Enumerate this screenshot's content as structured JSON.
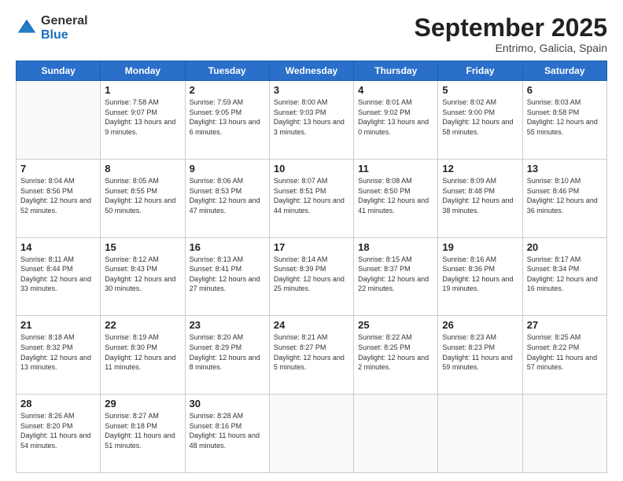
{
  "header": {
    "logo_general": "General",
    "logo_blue": "Blue",
    "month_title": "September 2025",
    "location": "Entrimo, Galicia, Spain"
  },
  "weekdays": [
    "Sunday",
    "Monday",
    "Tuesday",
    "Wednesday",
    "Thursday",
    "Friday",
    "Saturday"
  ],
  "weeks": [
    [
      {
        "day": null
      },
      {
        "day": 1,
        "sunrise": "7:58 AM",
        "sunset": "9:07 PM",
        "daylight": "13 hours and 9 minutes"
      },
      {
        "day": 2,
        "sunrise": "7:59 AM",
        "sunset": "9:05 PM",
        "daylight": "13 hours and 6 minutes"
      },
      {
        "day": 3,
        "sunrise": "8:00 AM",
        "sunset": "9:03 PM",
        "daylight": "13 hours and 3 minutes"
      },
      {
        "day": 4,
        "sunrise": "8:01 AM",
        "sunset": "9:02 PM",
        "daylight": "13 hours and 0 minutes"
      },
      {
        "day": 5,
        "sunrise": "8:02 AM",
        "sunset": "9:00 PM",
        "daylight": "12 hours and 58 minutes"
      },
      {
        "day": 6,
        "sunrise": "8:03 AM",
        "sunset": "8:58 PM",
        "daylight": "12 hours and 55 minutes"
      }
    ],
    [
      {
        "day": 7,
        "sunrise": "8:04 AM",
        "sunset": "8:56 PM",
        "daylight": "12 hours and 52 minutes"
      },
      {
        "day": 8,
        "sunrise": "8:05 AM",
        "sunset": "8:55 PM",
        "daylight": "12 hours and 50 minutes"
      },
      {
        "day": 9,
        "sunrise": "8:06 AM",
        "sunset": "8:53 PM",
        "daylight": "12 hours and 47 minutes"
      },
      {
        "day": 10,
        "sunrise": "8:07 AM",
        "sunset": "8:51 PM",
        "daylight": "12 hours and 44 minutes"
      },
      {
        "day": 11,
        "sunrise": "8:08 AM",
        "sunset": "8:50 PM",
        "daylight": "12 hours and 41 minutes"
      },
      {
        "day": 12,
        "sunrise": "8:09 AM",
        "sunset": "8:48 PM",
        "daylight": "12 hours and 38 minutes"
      },
      {
        "day": 13,
        "sunrise": "8:10 AM",
        "sunset": "8:46 PM",
        "daylight": "12 hours and 36 minutes"
      }
    ],
    [
      {
        "day": 14,
        "sunrise": "8:11 AM",
        "sunset": "8:44 PM",
        "daylight": "12 hours and 33 minutes"
      },
      {
        "day": 15,
        "sunrise": "8:12 AM",
        "sunset": "8:43 PM",
        "daylight": "12 hours and 30 minutes"
      },
      {
        "day": 16,
        "sunrise": "8:13 AM",
        "sunset": "8:41 PM",
        "daylight": "12 hours and 27 minutes"
      },
      {
        "day": 17,
        "sunrise": "8:14 AM",
        "sunset": "8:39 PM",
        "daylight": "12 hours and 25 minutes"
      },
      {
        "day": 18,
        "sunrise": "8:15 AM",
        "sunset": "8:37 PM",
        "daylight": "12 hours and 22 minutes"
      },
      {
        "day": 19,
        "sunrise": "8:16 AM",
        "sunset": "8:36 PM",
        "daylight": "12 hours and 19 minutes"
      },
      {
        "day": 20,
        "sunrise": "8:17 AM",
        "sunset": "8:34 PM",
        "daylight": "12 hours and 16 minutes"
      }
    ],
    [
      {
        "day": 21,
        "sunrise": "8:18 AM",
        "sunset": "8:32 PM",
        "daylight": "12 hours and 13 minutes"
      },
      {
        "day": 22,
        "sunrise": "8:19 AM",
        "sunset": "8:30 PM",
        "daylight": "12 hours and 11 minutes"
      },
      {
        "day": 23,
        "sunrise": "8:20 AM",
        "sunset": "8:29 PM",
        "daylight": "12 hours and 8 minutes"
      },
      {
        "day": 24,
        "sunrise": "8:21 AM",
        "sunset": "8:27 PM",
        "daylight": "12 hours and 5 minutes"
      },
      {
        "day": 25,
        "sunrise": "8:22 AM",
        "sunset": "8:25 PM",
        "daylight": "12 hours and 2 minutes"
      },
      {
        "day": 26,
        "sunrise": "8:23 AM",
        "sunset": "8:23 PM",
        "daylight": "11 hours and 59 minutes"
      },
      {
        "day": 27,
        "sunrise": "8:25 AM",
        "sunset": "8:22 PM",
        "daylight": "11 hours and 57 minutes"
      }
    ],
    [
      {
        "day": 28,
        "sunrise": "8:26 AM",
        "sunset": "8:20 PM",
        "daylight": "11 hours and 54 minutes"
      },
      {
        "day": 29,
        "sunrise": "8:27 AM",
        "sunset": "8:18 PM",
        "daylight": "11 hours and 51 minutes"
      },
      {
        "day": 30,
        "sunrise": "8:28 AM",
        "sunset": "8:16 PM",
        "daylight": "11 hours and 48 minutes"
      },
      {
        "day": null
      },
      {
        "day": null
      },
      {
        "day": null
      },
      {
        "day": null
      }
    ]
  ]
}
